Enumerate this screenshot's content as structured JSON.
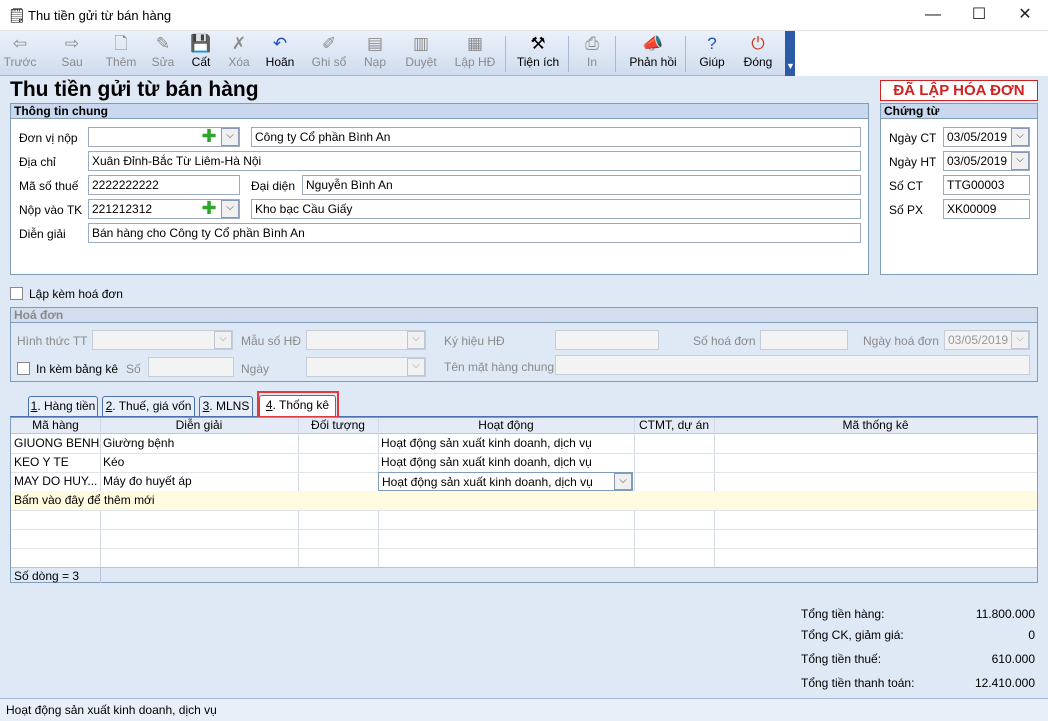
{
  "window": {
    "title": "Thu tiền gửi từ bán hàng",
    "min": "—",
    "max": "☐",
    "close": "✕"
  },
  "toolbar": [
    {
      "id": "prev",
      "label": "Trước",
      "icon": "⇦",
      "enabled": false
    },
    {
      "id": "next",
      "label": "Sau",
      "icon": "⇨",
      "enabled": false
    },
    {
      "id": "add",
      "label": "Thêm",
      "icon": "🗋",
      "enabled": false
    },
    {
      "id": "edit",
      "label": "Sửa",
      "icon": "✎",
      "enabled": false
    },
    {
      "id": "save",
      "label": "Cất",
      "icon": "💾",
      "enabled": true
    },
    {
      "id": "delete",
      "label": "Xóa",
      "icon": "✗",
      "enabled": false
    },
    {
      "id": "undo",
      "label": "Hoãn",
      "icon": "↶",
      "enabled": true
    },
    {
      "id": "post",
      "label": "Ghi sổ",
      "icon": "✐",
      "enabled": false
    },
    {
      "id": "unpost",
      "label": "Nạp",
      "icon": "▤",
      "enabled": false
    },
    {
      "id": "browse",
      "label": "Duyệt",
      "icon": "▥",
      "enabled": false
    },
    {
      "id": "invoice",
      "label": "Lập HĐ",
      "icon": "▦",
      "enabled": false
    },
    {
      "id": "utilities",
      "label": "Tiện ích",
      "icon": "⚒",
      "enabled": true
    },
    {
      "id": "print",
      "label": "In",
      "icon": "⎙",
      "enabled": false
    },
    {
      "id": "feedback",
      "label": "Phản hồi",
      "icon": "📣",
      "enabled": true
    },
    {
      "id": "help",
      "label": "Giúp",
      "icon": "?",
      "enabled": true
    },
    {
      "id": "close",
      "label": "Đóng",
      "icon": "⏻",
      "enabled": true
    }
  ],
  "heading": "Thu tiền gửi từ bán hàng",
  "status_stamp": "ĐÃ LẬP HÓA ĐƠN",
  "general": {
    "title": "Thông tin chung",
    "payer_label": "Đơn vị nộp",
    "payer_code": "",
    "payer_name": "Công ty Cổ phần Bình An",
    "address_label": "Địa chỉ",
    "address": "Xuân Đỉnh-Bắc Từ Liêm-Hà Nội",
    "tax_label": "Mã số thuế",
    "tax_code": "2222222222",
    "rep_label": "Đại diện",
    "rep": "Nguyễn Bình An",
    "account_label": "Nộp vào TK",
    "account": "221212312",
    "bank": "Kho bạc Cầu Giấy",
    "desc_label": "Diễn giải",
    "desc": "Bán hàng cho Công ty Cổ phần Bình An"
  },
  "voucher": {
    "title": "Chứng từ",
    "date_ct_label": "Ngày CT",
    "date_ct": "03/05/2019",
    "date_ht_label": "Ngày HT",
    "date_ht": "03/05/2019",
    "no_ct_label": "Số CT",
    "no_ct": "TTG00003",
    "no_px_label": "Số PX",
    "no_px": "XK00009"
  },
  "attach_invoice_label": "Lập kèm hoá đơn",
  "invoice": {
    "title": "Hoá đơn",
    "payment_label": "Hình thức TT",
    "form_label": "Mẫu số HĐ",
    "symbol_label": "Ký hiệu HĐ",
    "number_label": "Số hoá đơn",
    "date_label": "Ngày hoá đơn",
    "date": "03/05/2019",
    "print_list_label": "In kèm bảng kê",
    "so_label": "Số",
    "ngay_label": "Ngày",
    "common_item_label": "Tên mặt hàng chung"
  },
  "tabs": [
    {
      "key": "1",
      "rest": ". Hàng tiền"
    },
    {
      "key": "2",
      "rest": ". Thuế, giá vốn"
    },
    {
      "key": "3",
      "rest": ". MLNS"
    },
    {
      "key": "4",
      "rest": ". Thống kê"
    }
  ],
  "grid": {
    "columns": [
      "Mã hàng",
      "Diễn giải",
      "Đối tượng",
      "Hoạt động",
      "CTMT, dự án",
      "Mã thống kê"
    ],
    "rows": [
      [
        "GIUONG BENH",
        "Giường bệnh",
        "",
        "Hoạt động sản xuất kinh doanh, dịch vụ",
        "",
        ""
      ],
      [
        "KEO Y TE",
        "Kéo",
        "",
        "Hoạt động sản xuất kinh doanh, dịch vụ",
        "",
        ""
      ],
      [
        "MAY DO HUY...",
        "Máy đo huyết áp",
        "",
        "Hoạt động sản xuất kinh doanh, dịch vụ",
        "",
        ""
      ]
    ],
    "add_new": "Bấm vào đây để thêm mới",
    "row_count": "Số dòng = 3"
  },
  "totals": [
    {
      "label": "Tổng tiền hàng:",
      "value": "11.800.000"
    },
    {
      "label": "Tổng CK, giảm giá:",
      "value": "0"
    },
    {
      "label": "Tổng tiền thuế:",
      "value": "610.000"
    },
    {
      "label": "Tổng tiền thanh toán:",
      "value": "12.410.000"
    }
  ],
  "statusbar": "Hoạt động sản xuất kinh doanh, dịch vụ",
  "colors": {
    "highlight": "#d93030",
    "accent": "#2a5aa8"
  }
}
